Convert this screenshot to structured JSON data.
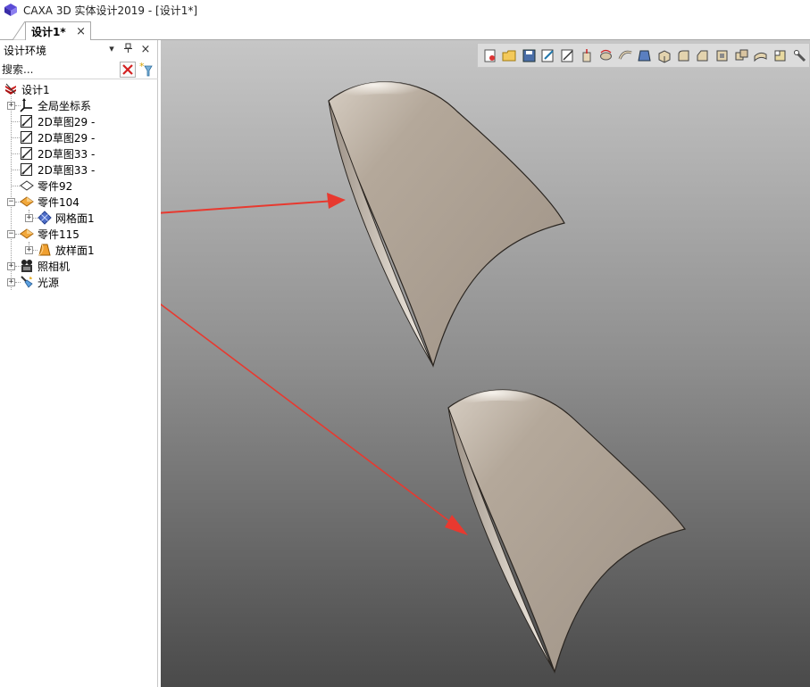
{
  "window": {
    "title": "CAXA 3D 实体设计2019 - [设计1*]"
  },
  "tab": {
    "label": "设计1*",
    "close": "×"
  },
  "panel": {
    "title": "设计环境",
    "dropdown_glyph": "▾",
    "pin_glyph": "ꟸ",
    "close_glyph": "×",
    "search_placeholder": "搜索..."
  },
  "tree": {
    "root": "设计1",
    "items": [
      {
        "label": "全局坐标系",
        "icon": "coordinate-system-icon"
      },
      {
        "label": "2D草图29 -",
        "icon": "sketch-icon"
      },
      {
        "label": "2D草图29 -",
        "icon": "sketch-icon"
      },
      {
        "label": "2D草图33 -",
        "icon": "sketch-icon"
      },
      {
        "label": "2D草图33 -",
        "icon": "sketch-icon"
      },
      {
        "label": "零件92",
        "icon": "part-outline-icon"
      },
      {
        "label": "零件104",
        "icon": "part-icon"
      },
      {
        "label": "网格面1",
        "icon": "mesh-surface-icon"
      },
      {
        "label": "零件115",
        "icon": "part-icon"
      },
      {
        "label": "放样面1",
        "icon": "loft-surface-icon"
      },
      {
        "label": "照相机",
        "icon": "camera-icon"
      },
      {
        "label": "光源",
        "icon": "light-icon"
      }
    ]
  },
  "toolbar": {
    "icons": [
      "new-icon",
      "open-icon",
      "save-icon",
      "edit-icon",
      "sketch-edit-icon",
      "extrude-icon",
      "revolve-icon",
      "sweep-icon",
      "loft-icon",
      "box-icon",
      "fillet-icon",
      "chamfer-icon",
      "shell-icon",
      "boolean-icon",
      "surface-icon",
      "face-icon",
      "measure-icon"
    ]
  },
  "colors": {
    "arrow": "#e8392f",
    "surface": "#a89c8f",
    "part_orange": "#f2a83b",
    "mesh_blue": "#4f6fc9"
  }
}
